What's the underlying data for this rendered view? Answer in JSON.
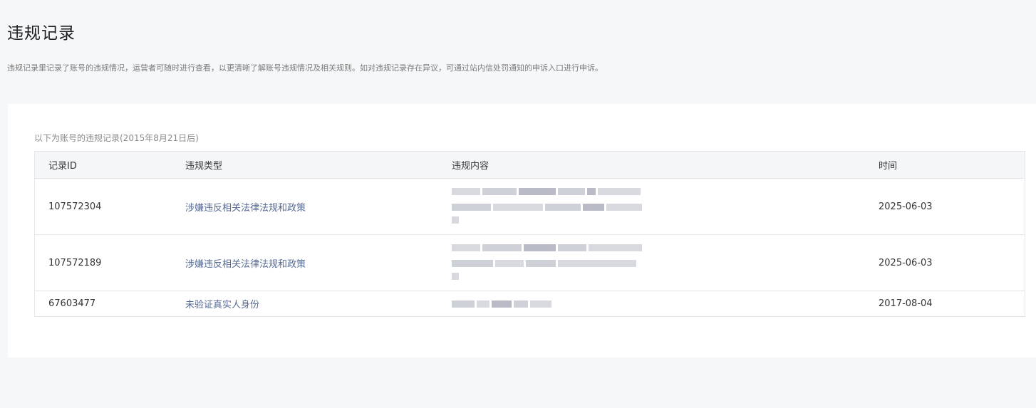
{
  "page": {
    "title": "违规记录",
    "description": "违规记录里记录了账号的违规情况，运营者可随时进行查看，以更清晰了解账号违规情况及相关规则。如对违规记录存在异议，可通过站内信处罚通知的申诉入口进行申诉。"
  },
  "records": {
    "caption": "以下为账号的违规记录(2015年8月21日后)",
    "columns": {
      "id": "记录ID",
      "type": "违规类型",
      "content": "违规内容",
      "time": "时间"
    },
    "rows": [
      {
        "id": "107572304",
        "type": "涉嫌违反相关法律法规和政策",
        "time": "2025-06-03"
      },
      {
        "id": "107572189",
        "type": "涉嫌违反相关法律法规和政策",
        "time": "2025-06-03"
      },
      {
        "id": "67603477",
        "type": "未验证真实人身份",
        "time": "2017-08-04"
      }
    ]
  },
  "colors": {
    "link": "#576b95",
    "background": "#f6f7f9",
    "header_bg": "#f5f6f8"
  }
}
